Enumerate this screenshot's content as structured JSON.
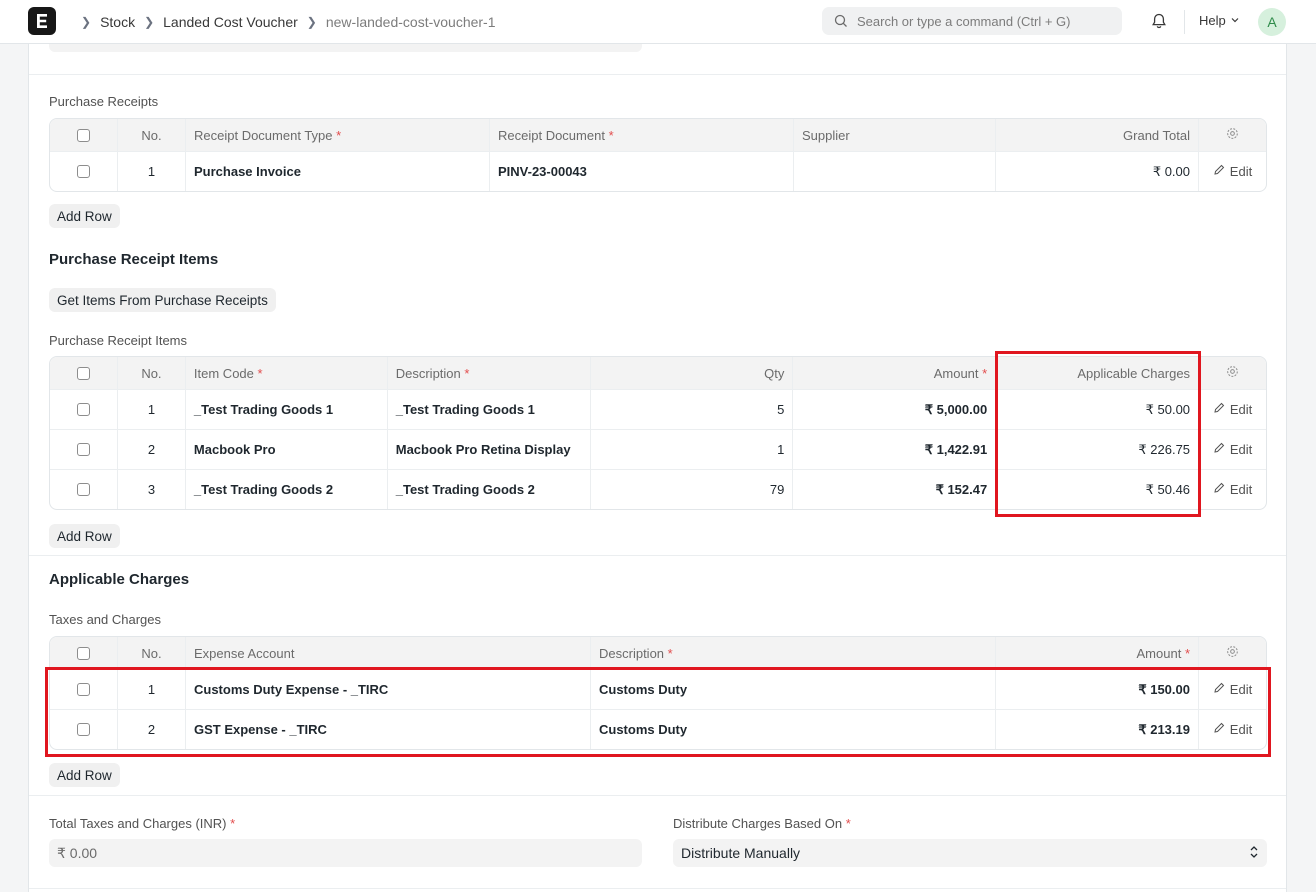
{
  "nav": {
    "breadcrumbs": [
      "Stock",
      "Landed Cost Voucher",
      "new-landed-cost-voucher-1"
    ],
    "search_placeholder": "Search or type a command (Ctrl + G)",
    "help_label": "Help",
    "avatar_initial": "A"
  },
  "purchase_receipts": {
    "grid_label": "Purchase Receipts",
    "columns": {
      "no": "No.",
      "doc_type": "Receipt Document Type",
      "doc": "Receipt Document",
      "supplier": "Supplier",
      "grand_total": "Grand Total"
    },
    "rows": [
      {
        "no": "1",
        "doc_type": "Purchase Invoice",
        "doc": "PINV-23-00043",
        "supplier": "",
        "grand_total": "₹ 0.00",
        "edit": "Edit"
      }
    ],
    "add_row": "Add Row"
  },
  "receipt_items": {
    "section_title": "Purchase Receipt Items",
    "get_items_button": "Get Items From Purchase Receipts",
    "grid_label": "Purchase Receipt Items",
    "columns": {
      "no": "No.",
      "item_code": "Item Code",
      "description": "Description",
      "qty": "Qty",
      "amount": "Amount",
      "applicable_charges": "Applicable Charges"
    },
    "rows": [
      {
        "no": "1",
        "item_code": "_Test Trading Goods 1",
        "description": "_Test Trading Goods 1",
        "qty": "5",
        "amount": "₹ 5,000.00",
        "applicable_charges": "₹ 50.00",
        "edit": "Edit"
      },
      {
        "no": "2",
        "item_code": "Macbook Pro",
        "description": "Macbook Pro Retina Display",
        "qty": "1",
        "amount": "₹ 1,422.91",
        "applicable_charges": "₹ 226.75",
        "edit": "Edit"
      },
      {
        "no": "3",
        "item_code": "_Test Trading Goods 2",
        "description": "_Test Trading Goods 2",
        "qty": "79",
        "amount": "₹ 152.47",
        "applicable_charges": "₹ 50.46",
        "edit": "Edit"
      }
    ],
    "add_row": "Add Row"
  },
  "applicable_charges": {
    "section_title": "Applicable Charges",
    "grid_label": "Taxes and Charges",
    "columns": {
      "no": "No.",
      "expense_account": "Expense Account",
      "description": "Description",
      "amount": "Amount"
    },
    "rows": [
      {
        "no": "1",
        "expense_account": "Customs Duty Expense - _TIRC",
        "description": "Customs Duty",
        "amount": "₹ 150.00",
        "edit": "Edit"
      },
      {
        "no": "2",
        "expense_account": "GST Expense - _TIRC",
        "description": "Customs Duty",
        "amount": "₹ 213.19",
        "edit": "Edit"
      }
    ],
    "add_row": "Add Row"
  },
  "totals": {
    "total_label": "Total Taxes and Charges (INR)",
    "total_value": "₹ 0.00",
    "distribute_label": "Distribute Charges Based On",
    "distribute_value": "Distribute Manually"
  },
  "colors": {
    "highlight": "#e0161f",
    "required": "#e24c4c"
  }
}
